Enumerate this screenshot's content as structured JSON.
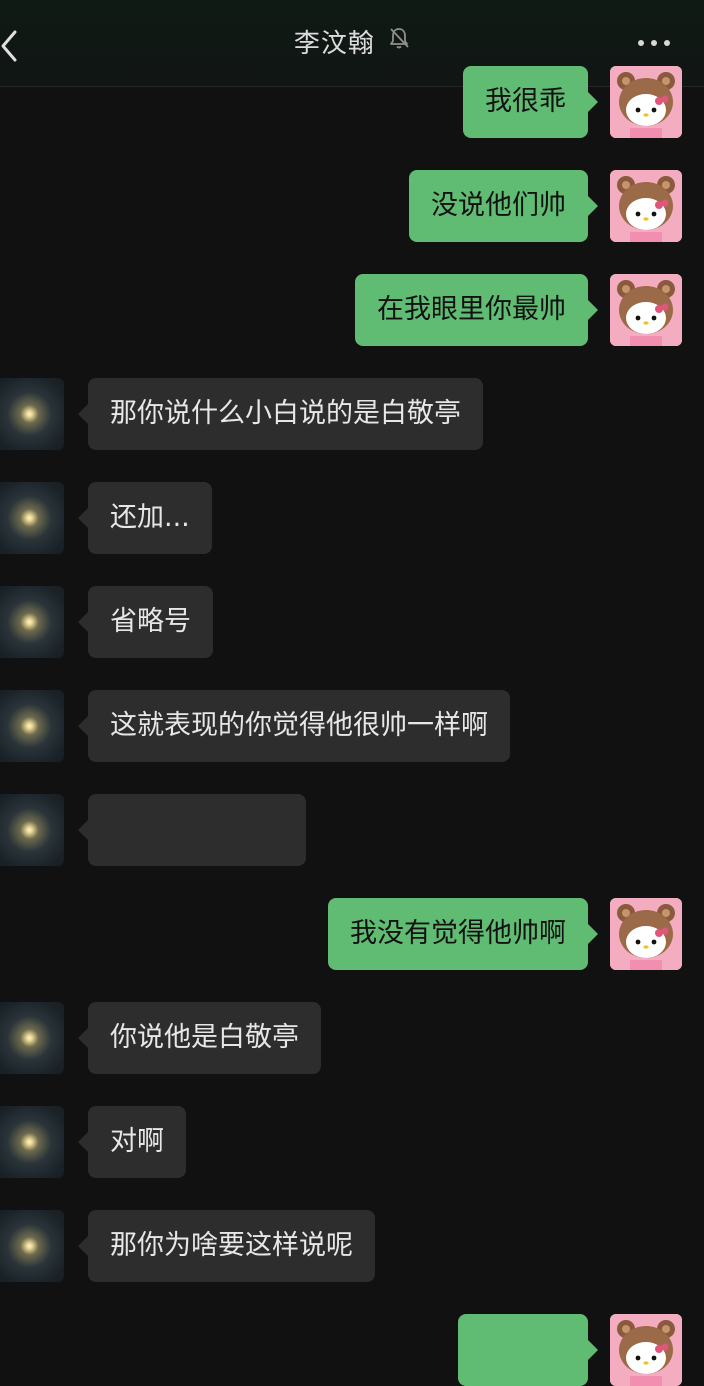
{
  "header": {
    "title": "李汶翰",
    "muted_icon": "bell-slash-icon",
    "back_icon": "chevron-left-icon",
    "more_icon": "more-dots-icon"
  },
  "messages": [
    {
      "side": "me",
      "text": "我很乖"
    },
    {
      "side": "me",
      "text": "没说他们帅"
    },
    {
      "side": "me",
      "text": "在我眼里你最帅"
    },
    {
      "side": "other",
      "text": "那你说什么小白说的是白敬亭"
    },
    {
      "side": "other",
      "text": "还加..."
    },
    {
      "side": "other",
      "text": "省略号"
    },
    {
      "side": "other",
      "text": "这就表现的你觉得他很帅一样啊"
    },
    {
      "side": "other",
      "text": ""
    },
    {
      "side": "me",
      "text": "我没有觉得他帅啊"
    },
    {
      "side": "other",
      "text": "你说他是白敬亭"
    },
    {
      "side": "other",
      "text": "对啊"
    },
    {
      "side": "other",
      "text": "那你为啥要这样说呢"
    },
    {
      "side": "me",
      "text": ""
    }
  ],
  "colors": {
    "me_bubble": "#5fbc72",
    "other_bubble": "#2d2d2d",
    "background": "#111111"
  }
}
